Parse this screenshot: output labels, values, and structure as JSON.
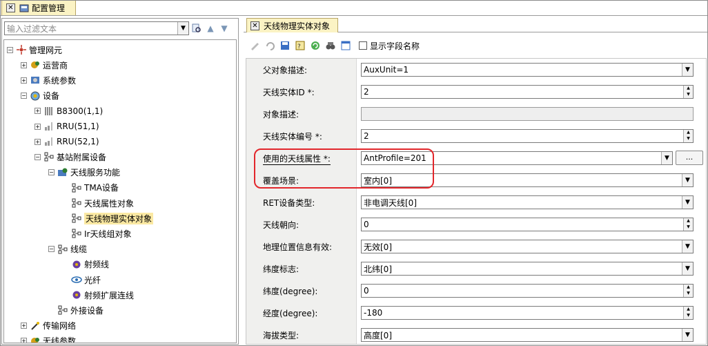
{
  "top_tab": {
    "label": "配置管理",
    "icon": "config-icon"
  },
  "left": {
    "filter_placeholder": "输入过滤文本",
    "tree": [
      {
        "label": "管理网元",
        "depth": 0,
        "expander": "−",
        "icon": "network-element-icon"
      },
      {
        "label": "运营商",
        "depth": 1,
        "expander": "+",
        "icon": "operator-icon"
      },
      {
        "label": "系统参数",
        "depth": 1,
        "expander": "+",
        "icon": "system-params-icon"
      },
      {
        "label": "设备",
        "depth": 1,
        "expander": "−",
        "icon": "device-icon"
      },
      {
        "label": "B8300(1,1)",
        "depth": 2,
        "expander": "+",
        "icon": "rack-icon"
      },
      {
        "label": "RRU(51,1)",
        "depth": 2,
        "expander": "+",
        "icon": "rru-icon"
      },
      {
        "label": "RRU(52,1)",
        "depth": 2,
        "expander": "+",
        "icon": "rru-icon"
      },
      {
        "label": "基站附属设备",
        "depth": 2,
        "expander": "−",
        "icon": "node-icon"
      },
      {
        "label": "天线服务功能",
        "depth": 3,
        "expander": "−",
        "icon": "antenna-service-icon"
      },
      {
        "label": "TMA设备",
        "depth": 4,
        "expander": "",
        "icon": "node-icon"
      },
      {
        "label": "天线属性对象",
        "depth": 4,
        "expander": "",
        "icon": "node-icon"
      },
      {
        "label": "天线物理实体对象",
        "depth": 4,
        "expander": "",
        "icon": "node-icon",
        "selected": true
      },
      {
        "label": "Ir天线组对象",
        "depth": 4,
        "expander": "",
        "icon": "node-icon"
      },
      {
        "label": "线缆",
        "depth": 3,
        "expander": "−",
        "icon": "node-icon"
      },
      {
        "label": "射频线",
        "depth": 4,
        "expander": "",
        "icon": "rf-cable-icon"
      },
      {
        "label": "光纤",
        "depth": 4,
        "expander": "",
        "icon": "fiber-icon"
      },
      {
        "label": "射频扩展连线",
        "depth": 4,
        "expander": "",
        "icon": "rf-cable-icon"
      },
      {
        "label": "外接设备",
        "depth": 3,
        "expander": "",
        "icon": "node-icon"
      },
      {
        "label": "传输网络",
        "depth": 1,
        "expander": "+",
        "icon": "transport-icon"
      },
      {
        "label": "无线参数",
        "depth": 1,
        "expander": "+",
        "icon": "wireless-params-icon"
      }
    ]
  },
  "right": {
    "tab_label": "天线物理实体对象",
    "show_field_names": "显示字段名称",
    "fields": [
      {
        "label": "父对象描述:",
        "value": "AuxUnit=1",
        "control": "dropdown"
      },
      {
        "label": "天线实体ID *:",
        "value": "2",
        "control": "spinner"
      },
      {
        "label": "对象描述:",
        "value": "",
        "control": "disabled"
      },
      {
        "label": "天线实体编号 *:",
        "value": "2",
        "control": "spinner"
      },
      {
        "label": "使用的天线属性 *:",
        "value": "AntProfile=201",
        "control": "dropdown-more",
        "more_label": "..."
      },
      {
        "label": "覆盖场景:",
        "value": "室内[0]",
        "control": "dropdown"
      },
      {
        "label": "RET设备类型:",
        "value": "非电调天线[0]",
        "control": "dropdown"
      },
      {
        "label": "天线朝向:",
        "value": "0",
        "control": "spinner"
      },
      {
        "label": "地理位置信息有效:",
        "value": "无效[0]",
        "control": "dropdown"
      },
      {
        "label": "纬度标志:",
        "value": "北纬[0]",
        "control": "dropdown"
      },
      {
        "label": "纬度(degree):",
        "value": "0",
        "control": "spinner"
      },
      {
        "label": "经度(degree):",
        "value": "-180",
        "control": "spinner"
      },
      {
        "label": "海拔类型:",
        "value": "高度[0]",
        "control": "dropdown"
      }
    ]
  },
  "colors": {
    "highlight": "#e2262b",
    "tab_bg": "#fbf3c4",
    "selected_bg": "#fbe9a3"
  }
}
